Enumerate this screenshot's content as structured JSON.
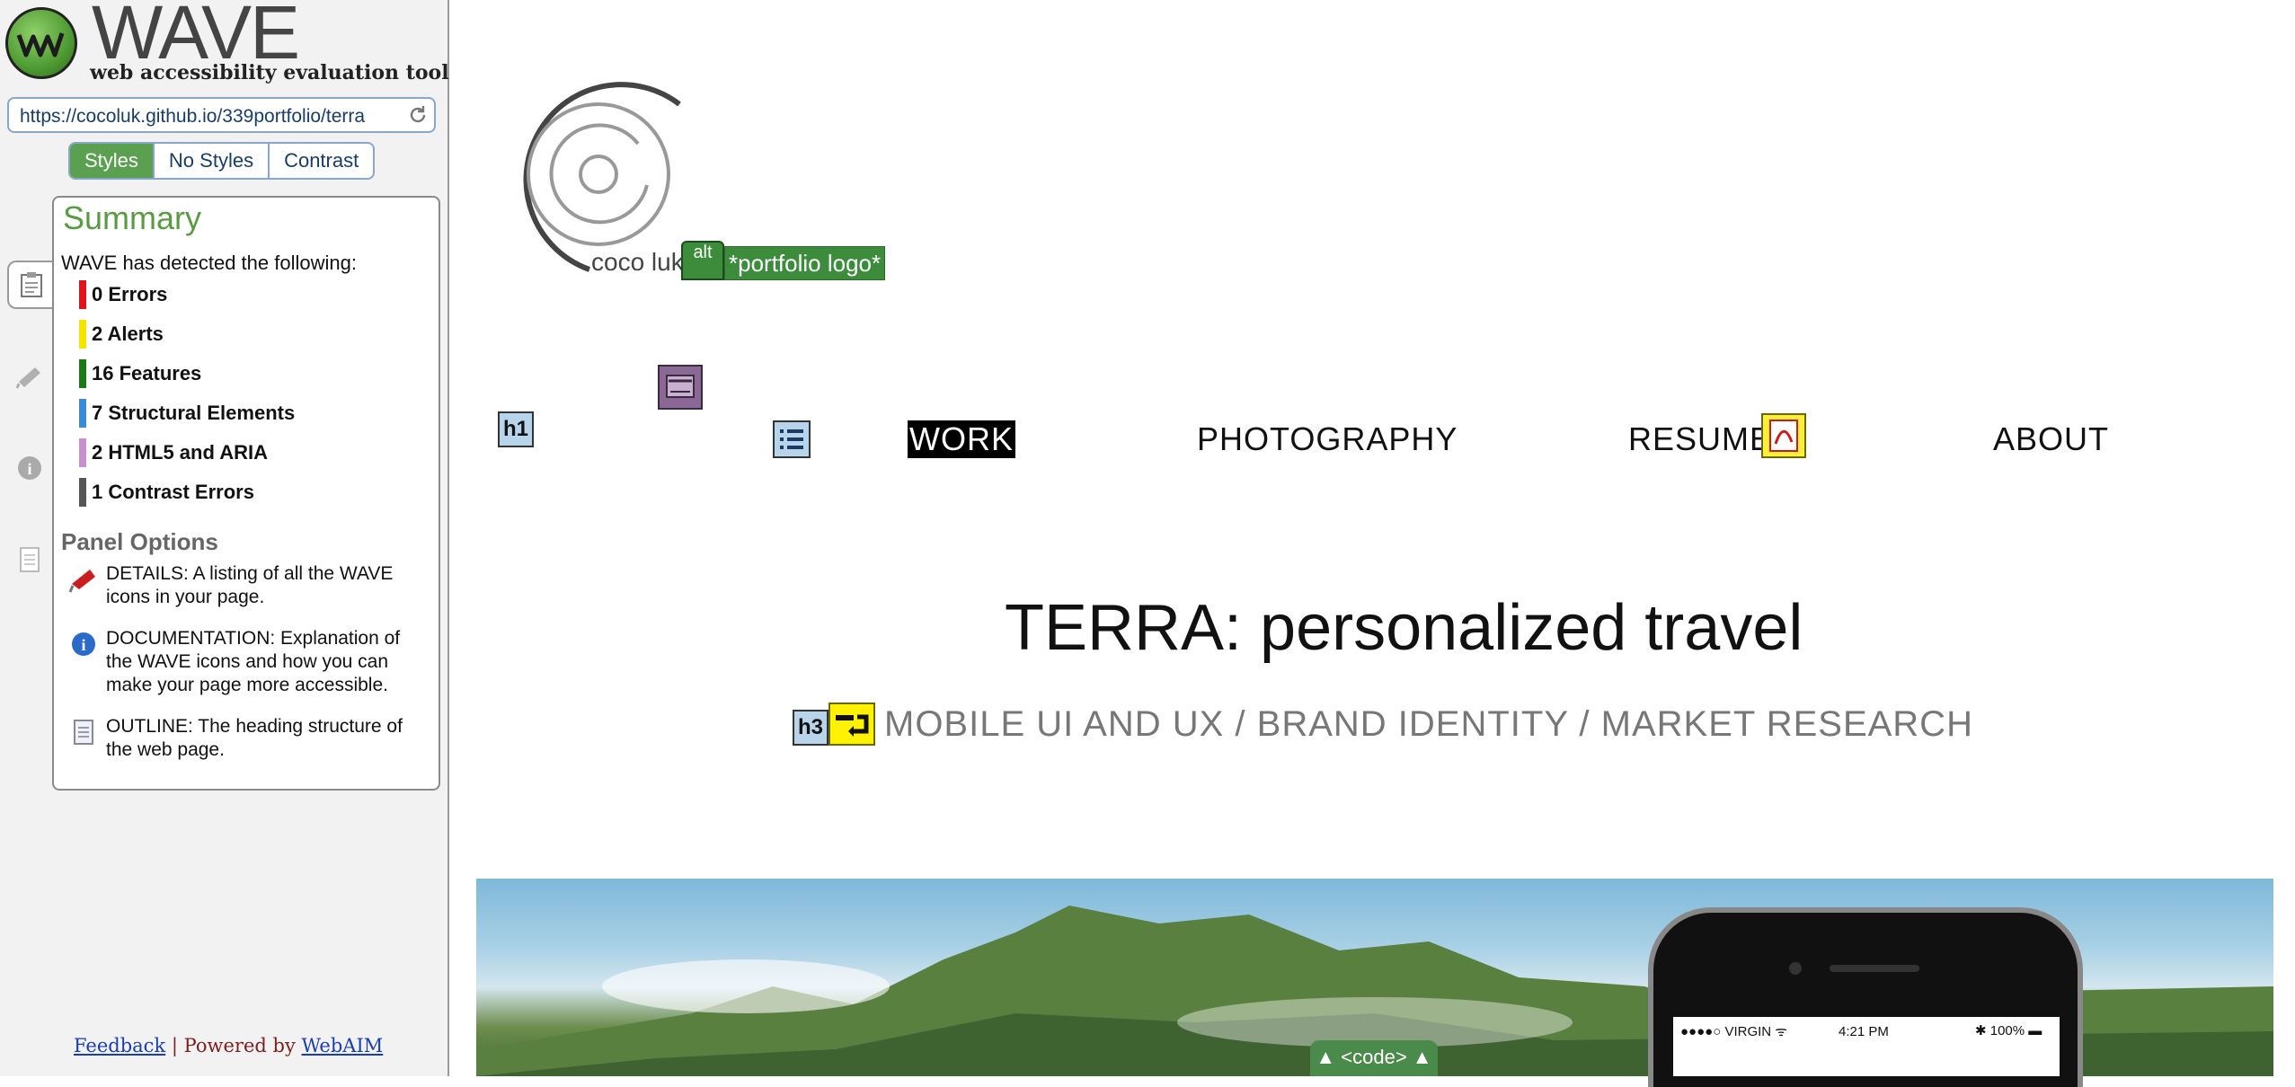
{
  "wave": {
    "title": "WAVE",
    "tagline": "web accessibility evaluation tool",
    "url": "https://cocoluk.github.io/339portfolio/terra",
    "view_tabs": [
      "Styles",
      "No Styles",
      "Contrast"
    ],
    "active_tab": "Styles",
    "summary": {
      "heading": "Summary",
      "intro": "WAVE has detected the following:",
      "counts": [
        {
          "label": "0 Errors",
          "color": "#e0141e"
        },
        {
          "label": "2 Alerts",
          "color": "#f5e400"
        },
        {
          "label": "16 Features",
          "color": "#1a7a1a"
        },
        {
          "label": "7 Structural Elements",
          "color": "#3a8ad8"
        },
        {
          "label": "2 HTML5 and ARIA",
          "color": "#c890cc"
        },
        {
          "label": "1 Contrast Errors",
          "color": "#555555"
        }
      ]
    },
    "panel_options": {
      "heading": "Panel Options",
      "details": "DETAILS: A listing of all the WAVE icons in your page.",
      "documentation": "DOCUMENTATION: Explanation of the WAVE icons and how you can make your page more accessible.",
      "outline": "OUTLINE: The heading structure of the web page."
    },
    "footer": {
      "feedback": "Feedback",
      "separator": "|",
      "powered": "Powered by",
      "webaim": "WebAIM"
    }
  },
  "site": {
    "logo_text": "coco luk",
    "alt_icon": "alt",
    "alt_text": "*portfolio logo*",
    "h1_icon": "h1",
    "nav": [
      "WORK",
      "PHOTOGRAPHY",
      "RESUME",
      "ABOUT"
    ],
    "project_title": "TERRA: personalized travel",
    "h3_icon": "h3",
    "subtitle": "MOBILE UI AND UX / BRAND IDENTITY / MARKET RESEARCH",
    "code_icon": "▲ <code> ▲",
    "phone_status": {
      "carrier": "●●●●○ VIRGIN ᯤ",
      "time": "4:21 PM",
      "battery": "✱ 100% ▬"
    }
  }
}
